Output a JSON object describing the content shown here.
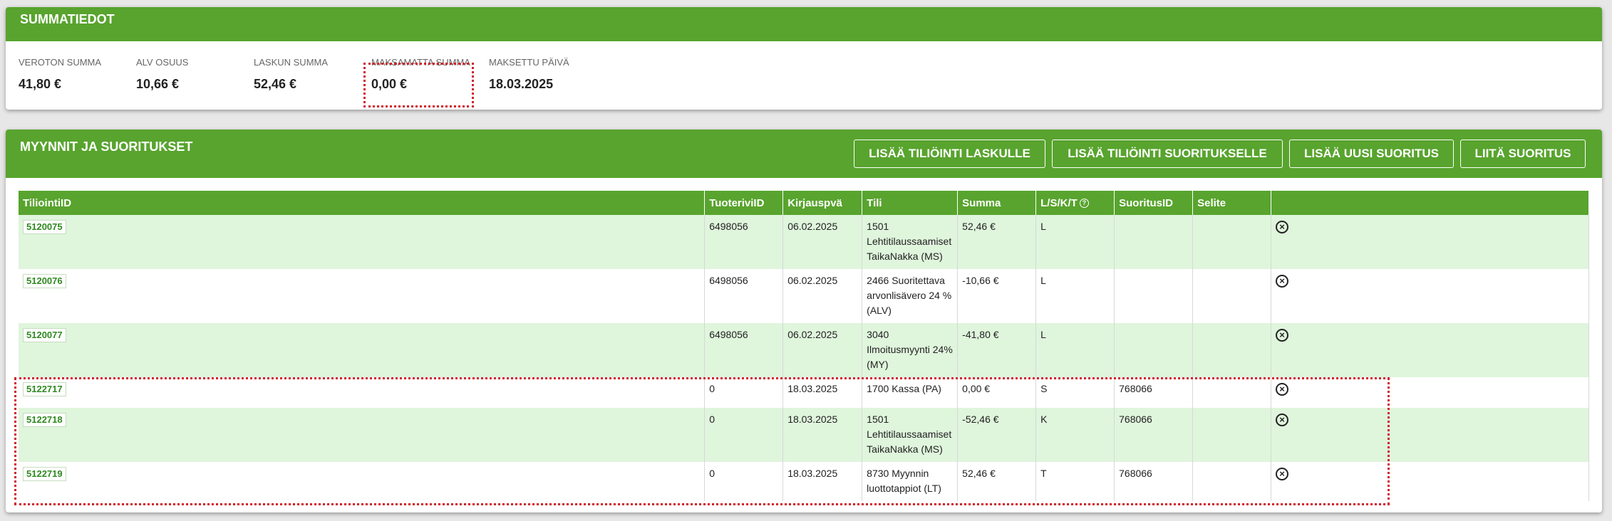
{
  "summary": {
    "title": "SUMMATIEDOT",
    "items": [
      {
        "label": "VEROTON SUMMA",
        "value": "41,80 €"
      },
      {
        "label": "ALV OSUUS",
        "value": "10,66 €"
      },
      {
        "label": "LASKUN SUMMA",
        "value": "52,46 €"
      },
      {
        "label": "MAKSAMATTA SUMMA",
        "value": "0,00 €"
      },
      {
        "label": "MAKSETTU PÄIVÄ",
        "value": "18.03.2025"
      }
    ]
  },
  "sales": {
    "title": "MYYNNIT JA SUORITUKSET",
    "buttons": {
      "add_invoice_posting": "LISÄÄ TILIÖINTI LASKULLE",
      "add_payment_posting": "LISÄÄ TILIÖINTI SUORITUKSELLE",
      "add_new_payment": "LISÄÄ UUSI SUORITUS",
      "attach_payment": "LIITÄ SUORITUS"
    },
    "columns": [
      "TiliointiID",
      "TuoteriviID",
      "Kirjauspvä",
      "Tili",
      "Summa",
      "L/S/K/T",
      "SuoritusID",
      "Selite",
      ""
    ],
    "help_icon": "question-icon",
    "delete_icon": "close-circle-icon",
    "rows": [
      {
        "id": "5120075",
        "tuoterivi": "6498056",
        "pvm": "06.02.2025",
        "tili": "1501 Lehtitilaussaamiset TaikaNakka (MS)",
        "summa": "52,46 €",
        "lskt": "L",
        "suoritus": "",
        "selite": ""
      },
      {
        "id": "5120076",
        "tuoterivi": "6498056",
        "pvm": "06.02.2025",
        "tili": "2466 Suoritettava arvonlisävero 24 % (ALV)",
        "summa": "-10,66 €",
        "lskt": "L",
        "suoritus": "",
        "selite": ""
      },
      {
        "id": "5120077",
        "tuoterivi": "6498056",
        "pvm": "06.02.2025",
        "tili": "3040 Ilmoitusmyynti 24% (MY)",
        "summa": "-41,80 €",
        "lskt": "L",
        "suoritus": "",
        "selite": ""
      },
      {
        "id": "5122717",
        "tuoterivi": "0",
        "pvm": "18.03.2025",
        "tili": "1700 Kassa (PA)",
        "summa": "0,00 €",
        "lskt": "S",
        "suoritus": "768066",
        "selite": ""
      },
      {
        "id": "5122718",
        "tuoterivi": "0",
        "pvm": "18.03.2025",
        "tili": "1501 Lehtitilaussaamiset TaikaNakka (MS)",
        "summa": "-52,46 €",
        "lskt": "K",
        "suoritus": "768066",
        "selite": ""
      },
      {
        "id": "5122719",
        "tuoterivi": "0",
        "pvm": "18.03.2025",
        "tili": "8730 Myynnin luottotappiot (LT)",
        "summa": "52,46 €",
        "lskt": "T",
        "suoritus": "768066",
        "selite": ""
      }
    ]
  },
  "colors": {
    "brand_green": "#58a42e",
    "row_alt": "#dff5dc",
    "highlight_red": "#d0202a"
  }
}
